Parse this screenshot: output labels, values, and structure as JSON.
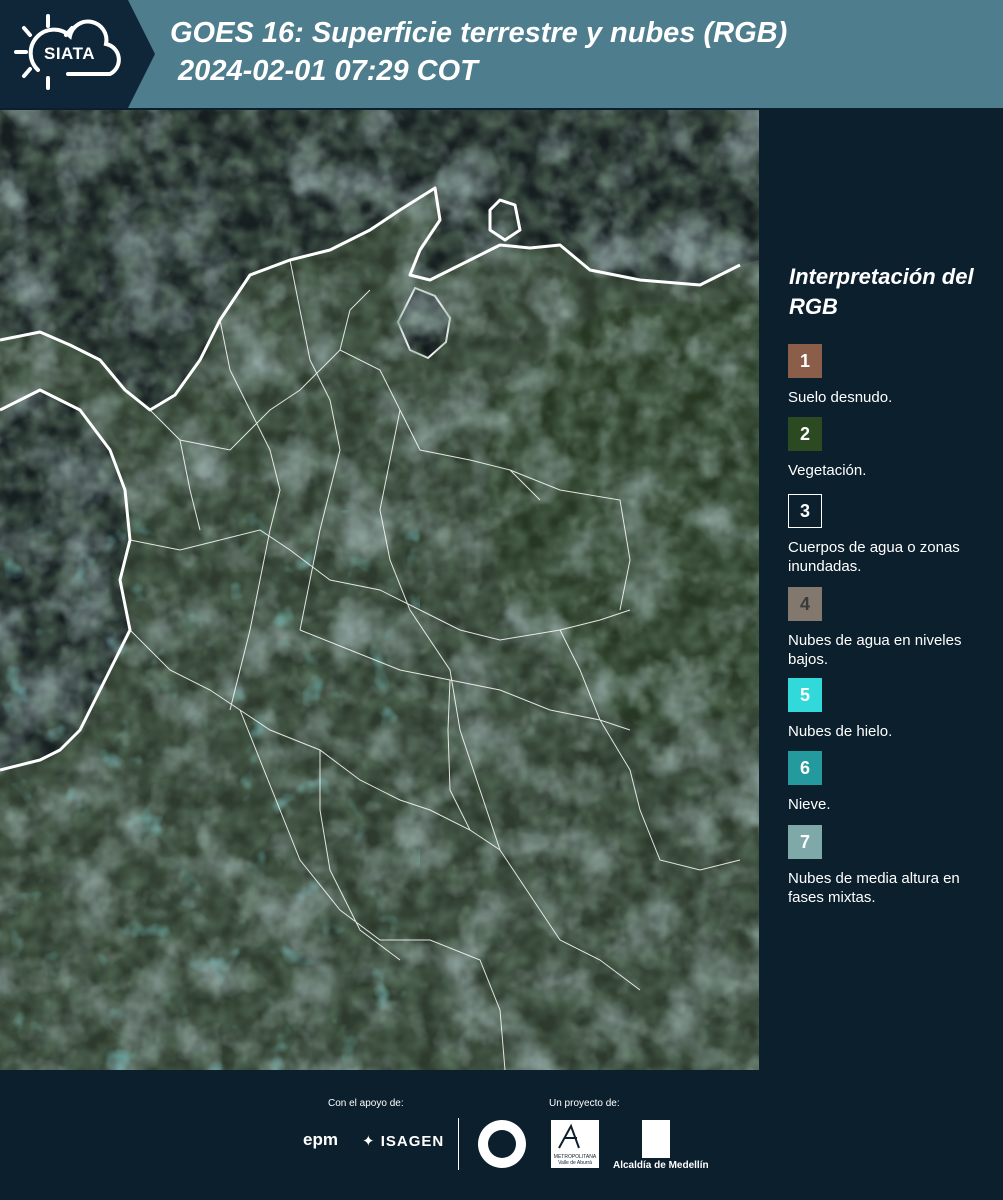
{
  "header": {
    "logo_text": "SIATA",
    "title_line1": "GOES 16: Superficie terrestre y nubes (RGB)",
    "title_line2": " 2024-02-01 07:29 COT"
  },
  "legend": {
    "title": "Interpretación del RGB",
    "items": [
      {
        "number": "1",
        "label": "Suelo desnudo.",
        "color": "#8a5e48"
      },
      {
        "number": "2",
        "label": "Vegetación.",
        "color": "#2c4a22"
      },
      {
        "number": "3",
        "label": "Cuerpos de agua o zonas inundadas.",
        "color": "#0c1f2d"
      },
      {
        "number": "4",
        "label": "Nubes de agua en niveles bajos.",
        "color": "#82786e"
      },
      {
        "number": "5",
        "label": "Nubes de hielo.",
        "color": "#31d9db"
      },
      {
        "number": "6",
        "label": "Nieve.",
        "color": "#259a9e"
      },
      {
        "number": "7",
        "label": "Nubes de media altura en fases mixtas.",
        "color": "#7fa9a9"
      }
    ]
  },
  "footer": {
    "support_label": "Con el apoyo de:",
    "project_label": "Un proyecto de:",
    "epm": "epm",
    "isagen": "ISAGEN",
    "area_text": "METROPOLITANA Valle de Aburrá",
    "alcaldia": "Alcaldía de Medellín"
  },
  "map": {
    "satellite": "GOES 16",
    "land_color": "#2f3b2e",
    "ocean_color": "#141c1f",
    "cloud_color": "#6f8c8e",
    "border_color": "#ffffff"
  }
}
